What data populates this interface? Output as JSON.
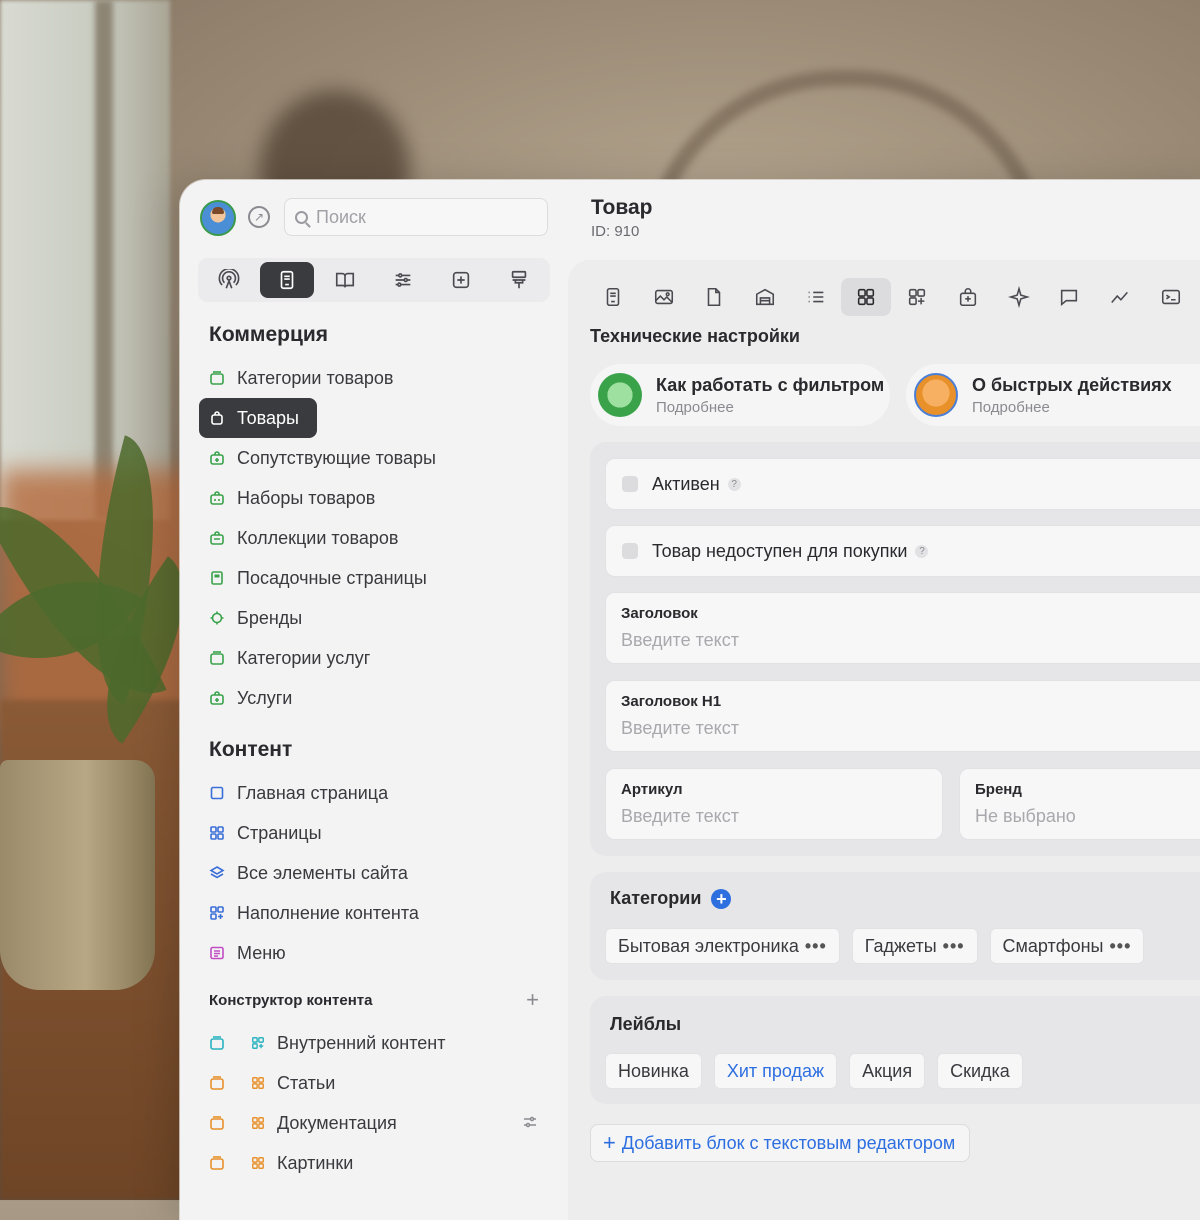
{
  "search": {
    "placeholder": "Поиск"
  },
  "sidebar": {
    "commerce_title": "Коммерция",
    "commerce_items": [
      "Категории товаров",
      "Товары",
      "Сопутствующие товары",
      "Наборы товаров",
      "Коллекции товаров",
      "Посадочные страницы",
      "Бренды",
      "Категории услуг",
      "Услуги"
    ],
    "content_title": "Контент",
    "content_items": [
      "Главная страница",
      "Страницы",
      "Все элементы сайта",
      "Наполнение контента",
      "Меню"
    ],
    "constructor_title": "Конструктор контента",
    "constructor_items": [
      "Внутренний контент",
      "Статьи",
      "Документация",
      "Картинки"
    ]
  },
  "header": {
    "title": "Товар",
    "subtitle": "ID: 910"
  },
  "main": {
    "section_title": "Технические настройки",
    "tips": [
      {
        "title": "Как работать с фильтром",
        "link": "Подробнее"
      },
      {
        "title": "О быстрых действиях",
        "link": "Подробнее"
      }
    ],
    "checkboxes": [
      {
        "label": "Активен",
        "help": "?"
      },
      {
        "label": "Товар недоступен для покупки",
        "help": "?"
      }
    ],
    "fields": {
      "heading": {
        "label": "Заголовок",
        "placeholder": "Введите текст"
      },
      "heading_h1": {
        "label": "Заголовок H1",
        "placeholder": "Введите текст"
      },
      "sku": {
        "label": "Артикул",
        "placeholder": "Введите текст"
      },
      "brand": {
        "label": "Бренд",
        "value": "Не выбрано"
      }
    },
    "categories": {
      "title": "Категории",
      "items": [
        "Бытовая электроника",
        "Гаджеты",
        "Смартфоны"
      ],
      "more": "•••"
    },
    "labels": {
      "title": "Лейблы",
      "items": [
        "Новинка",
        "Хит продаж",
        "Акция",
        "Скидка"
      ]
    },
    "add_block": "Добавить блок с текстовым редактором"
  },
  "colors": {
    "accent": "#2e6fe0",
    "active_bg": "#3a3b3f",
    "green": "#3aa34a",
    "blue": "#3a6fd8",
    "orange": "#e8902a"
  }
}
